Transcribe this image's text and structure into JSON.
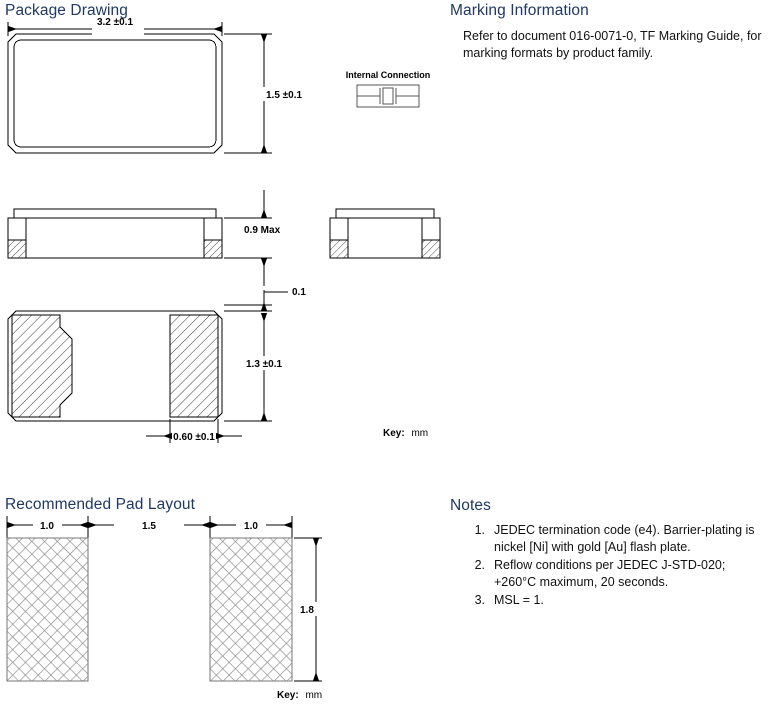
{
  "sections": {
    "package_drawing": {
      "title": "Package Drawing"
    },
    "marking_information": {
      "title": "Marking Information",
      "body": "Refer to document 016-0071-0, TF Marking Guide, for marking formats by product family."
    },
    "recommended_pad_layout": {
      "title": "Recommended Pad Layout"
    },
    "notes": {
      "title": "Notes",
      "items": [
        {
          "num": "1.",
          "text": "JEDEC termination code (e4).  Barrier-plating is nickel [Ni] with gold [Au] flash plate."
        },
        {
          "num": "2.",
          "text": "Reflow conditions per JEDEC J-STD-020; +260°C maximum, 20 seconds."
        },
        {
          "num": "3.",
          "text": "MSL = 1."
        }
      ]
    }
  },
  "package_drawing": {
    "internal_connection_label": "Internal Connection",
    "key_label_bold": "Key:",
    "key_label_unit": "mm",
    "dimensions": {
      "top_width": "3.2 ±0.1",
      "top_height": "1.5 ±0.1",
      "front_height": "0.9 Max",
      "standoff": "0.1",
      "pad_height": "1.3 ±0.1",
      "pad_width": "0.60 ±0.1"
    }
  },
  "pad_layout": {
    "key_label_bold": "Key:",
    "key_label_unit": "mm",
    "dimensions": {
      "left_pad_width": "1.0",
      "gap_width": "1.5",
      "right_pad_width": "1.0",
      "pad_height": "1.8"
    }
  },
  "colors": {
    "heading": "#1F3864",
    "line": "#000000",
    "hatch": "#555555"
  }
}
